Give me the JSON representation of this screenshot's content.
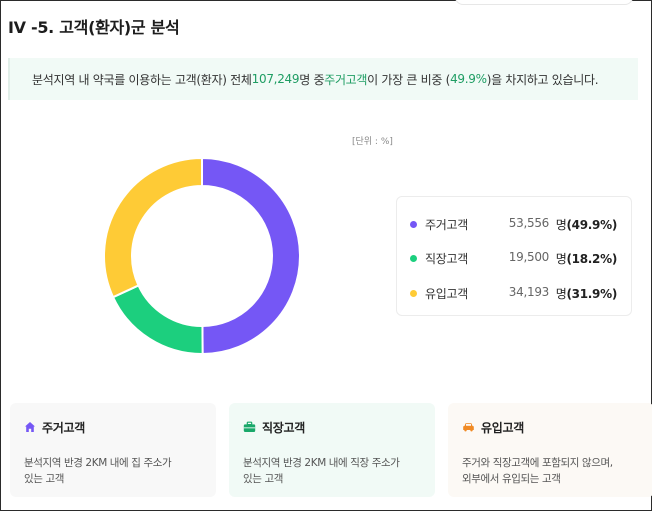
{
  "title": "IV -5. 고객(환자)군 분석",
  "summary": {
    "prefix": "분석지역 내 약국를 이용하는 고객(환자) 전체 ",
    "total": "107,249",
    "middle1": "명 중 ",
    "group": "주거고객",
    "middle2": "이 가장 큰 비중 (",
    "share": "49.9%",
    "suffix": ")을 차지하고 있습니다."
  },
  "unit_label": "[단위 : %]",
  "colors": {
    "residential": "#7557f5",
    "workplace": "#1ccf7e",
    "inflow": "#fecb36",
    "highlight": "#1f9d63"
  },
  "chart_data": {
    "type": "pie",
    "donut": true,
    "categories": [
      "주거고객",
      "직장고객",
      "유입고객"
    ],
    "values": [
      49.9,
      18.2,
      31.9
    ],
    "counts": [
      "53,556",
      "19,500",
      "34,193"
    ],
    "count_unit": "명"
  },
  "legend": [
    {
      "name": "주거고객",
      "count": "53,556",
      "unit": "명",
      "pct": "(49.9%)"
    },
    {
      "name": "직장고객",
      "count": "19,500",
      "unit": "명",
      "pct": "(18.2%)"
    },
    {
      "name": "유입고객",
      "count": "34,193",
      "unit": "명",
      "pct": "(31.9%)"
    }
  ],
  "cards": [
    {
      "title": "주거고객",
      "icon": "home-icon",
      "desc_line1": "분석지역 반경 2KM 내에 집 주소가",
      "desc_line2": "있는 고객"
    },
    {
      "title": "직장고객",
      "icon": "briefcase-icon",
      "desc_line1": "분석지역 반경 2KM 내에 직장 주소가",
      "desc_line2": "있는 고객"
    },
    {
      "title": "유입고객",
      "icon": "car-icon",
      "desc_line1": "주거와 직장고객에 포함되지 않으며,",
      "desc_line2": "외부에서 유입되는 고객"
    }
  ]
}
